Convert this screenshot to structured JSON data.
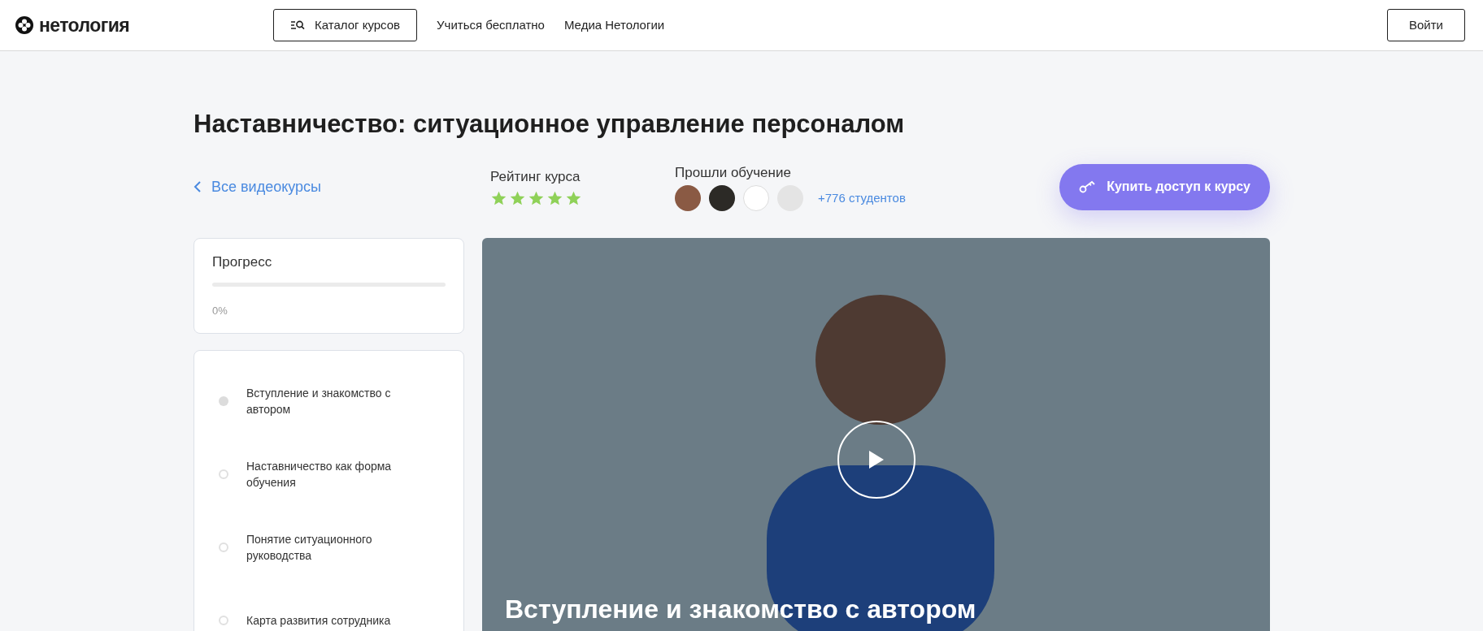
{
  "header": {
    "logo": "нетология",
    "catalog_button": "Каталог курсов",
    "nav": [
      "Учиться бесплатно",
      "Медиа Нетологии"
    ],
    "login_button": "Войти"
  },
  "course": {
    "title": "Наставничество: ситуационное управление персоналом",
    "back_link": "Все видеокурсы",
    "rating_label": "Рейтинг курса",
    "stars": 5,
    "students_label": "Прошли обучение",
    "students_count": "+776 студентов",
    "buy_button": "Купить доступ к курсу"
  },
  "progress": {
    "title": "Прогресс",
    "level": 0,
    "reading": "0%"
  },
  "lessons": [
    {
      "title": "Вступление и знакомство с автором",
      "selected": true
    },
    {
      "title": "Наставничество как форма обучения",
      "selected": false
    },
    {
      "title": "Понятие ситуационного руководства",
      "selected": false
    },
    {
      "title": "Карта развития сотрудника",
      "selected": false
    }
  ],
  "video": {
    "caption": "Вступление и знакомство с автором"
  }
}
